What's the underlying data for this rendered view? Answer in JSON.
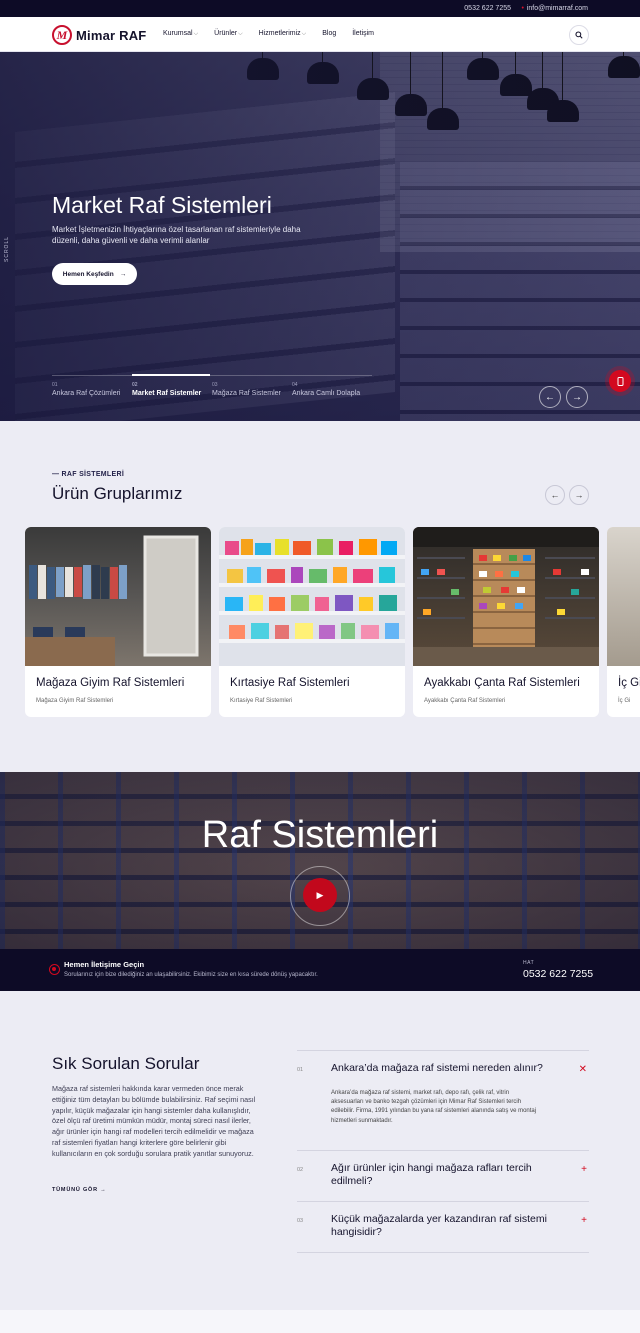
{
  "topbar": {
    "phone": "0532 622 7255",
    "separator": "•",
    "email": "info@mimarraf.com"
  },
  "brand": {
    "mark": "M",
    "name": "Mimar RAF",
    "accent": "#c8102e",
    "dark": "#0d0b26"
  },
  "nav": {
    "items": [
      {
        "label": "Kurumsal",
        "dropdown": true
      },
      {
        "label": "Ürünler",
        "dropdown": true
      },
      {
        "label": "Hizmetlerimiz",
        "dropdown": true
      },
      {
        "label": "Blog",
        "dropdown": false
      },
      {
        "label": "İletişim",
        "dropdown": false
      }
    ],
    "search_icon": "search-icon"
  },
  "hero": {
    "scroll_label": "SCROLL",
    "title": "Market Raf Sistemleri",
    "text": "Market İşletmenizin İhtiyaçlarına özel tasarlanan raf sistemleriyle daha düzenli, daha güvenli ve daha verimli alanlar",
    "cta": "Hemen Keşfedin",
    "slides": [
      {
        "num": "01",
        "label": "Ankara Raf Çözümleri"
      },
      {
        "num": "02",
        "label": "Market Raf Sistemler"
      },
      {
        "num": "03",
        "label": "Mağaza Raf Sistemler"
      },
      {
        "num": "04",
        "label": "Ankara Camlı Dolapla"
      }
    ],
    "active_slide": 1
  },
  "products": {
    "eyebrow": "— RAF SİSTEMLERİ",
    "title": "Ürün Gruplarımız",
    "cards": [
      {
        "title": "Mağaza Giyim Raf Sistemleri",
        "subtitle": "Mağaza Giyim Raf Sistemleri"
      },
      {
        "title": "Kırtasiye Raf Sistemleri",
        "subtitle": "Kırtasiye Raf Sistemleri"
      },
      {
        "title": "Ayakkabı Çanta Raf Sistemleri",
        "subtitle": "Ayakkabı Çanta Raf Sistemleri"
      },
      {
        "title": "İç Gi",
        "subtitle": "İç Gi"
      }
    ]
  },
  "video": {
    "title": "Raf Sistemleri"
  },
  "contact": {
    "title": "Hemen İletişime Geçin",
    "text": "Sorularınız için bize dilediğiniz an ulaşabilirsiniz. Ekibimiz size en kısa sürede dönüş yapacaktır.",
    "label": "HAT",
    "phone": "0532 622 7255"
  },
  "faq": {
    "title": "Sık Sorulan Sorular",
    "text": "Mağaza raf sistemleri hakkında karar vermeden önce merak ettiğiniz tüm detayları bu bölümde bulabilirsiniz. Raf seçimi nasıl yapılır, küçük mağazalar için hangi sistemler daha kullanışlıdır, özel ölçü raf üretimi mümkün müdür, montaj süreci nasıl ilerler, ağır ürünler için hangi raf modelleri tercih edilmelidir ve mağaza raf sistemleri fiyatları hangi kriterlere göre belirlenir gibi kullanıcıların en çok sorduğu sorulara pratik yanıtlar sunuyoruz.",
    "more": "TÜMÜNÜ GÖR",
    "items": [
      {
        "num": "01",
        "question": "Ankara’da mağaza raf sistemi nereden alınır?",
        "answer": "Ankara’da mağaza raf sistemi, market rafı, depo rafı, çelik raf, vitrin aksesuarları ve banko tezgah çözümleri için Mimar Raf Sistemleri tercih edilebilir. Firma, 1991 yılından bu yana raf sistemleri alanında satış ve montaj hizmetleri sunmaktadır.",
        "open": true
      },
      {
        "num": "02",
        "question": "Ağır ürünler için hangi mağaza rafları tercih edilmeli?",
        "answer": "",
        "open": false
      },
      {
        "num": "03",
        "question": "Küçük mağazalarda yer kazandıran raf sistemi hangisidir?",
        "answer": "",
        "open": false
      }
    ]
  }
}
